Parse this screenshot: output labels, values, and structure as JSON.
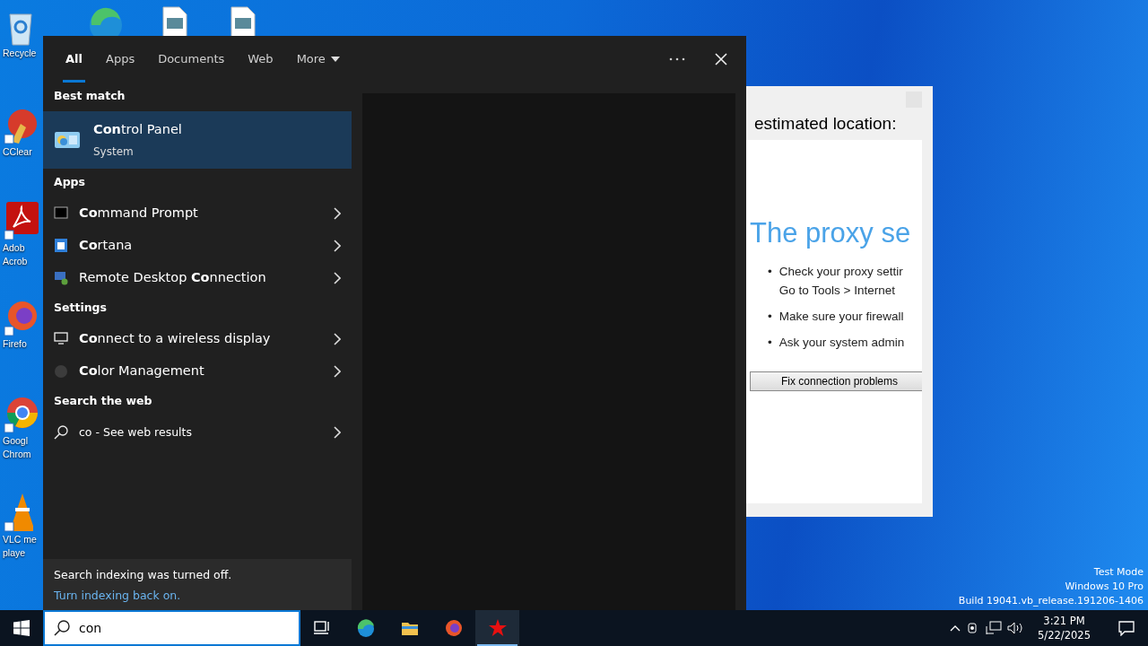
{
  "desktop": {
    "icons": [
      {
        "kind": "recycle",
        "lines": [
          "Recycle"
        ]
      },
      {
        "kind": "edge"
      },
      {
        "kind": "file"
      },
      {
        "kind": "file"
      },
      {
        "kind": "ccleaner",
        "lines": [
          "CClear"
        ]
      },
      {
        "kind": "acrobat",
        "lines": [
          "Adob",
          "Acrob"
        ]
      },
      {
        "kind": "firefox",
        "lines": [
          "Firefo"
        ]
      },
      {
        "kind": "chrome",
        "lines": [
          "Googl",
          "Chrom"
        ]
      },
      {
        "kind": "vlc",
        "lines": [
          "VLC me",
          "playe"
        ]
      }
    ],
    "system_info": [
      "Test Mode",
      "Windows 10 Pro",
      "Build 19041.vb_release.191206-1406"
    ]
  },
  "background_window": {
    "heading": "estimated location:",
    "title": "The proxy se",
    "bullets": [
      {
        "marker": "•",
        "lines": [
          "Check your proxy settir",
          "Go to Tools > Internet"
        ]
      },
      {
        "marker": "•",
        "lines": [
          "Make sure your firewall"
        ]
      },
      {
        "marker": "•",
        "lines": [
          "Ask your system admin"
        ]
      }
    ],
    "button": "Fix connection problems"
  },
  "search_panel": {
    "tabs": [
      {
        "label": "All",
        "selected": true
      },
      {
        "label": "Apps",
        "selected": false
      },
      {
        "label": "Documents",
        "selected": false
      },
      {
        "label": "Web",
        "selected": false
      },
      {
        "label": "More",
        "selected": false,
        "dropdown": true
      }
    ],
    "best_match": {
      "heading": "Best match",
      "title": "**Con**trol Panel",
      "subtitle": "System",
      "selected": true
    },
    "sections": [
      {
        "heading": "Apps",
        "items": [
          {
            "kind": "cmd",
            "label": "**Co**mmand Prompt",
            "selected": false
          },
          {
            "kind": "cortana",
            "label": "**Co**rtana",
            "selected": false
          },
          {
            "kind": "rdp",
            "label": "Remote Desktop **Co**nnection",
            "selected": false
          }
        ]
      },
      {
        "heading": "Settings",
        "items": [
          {
            "kind": "display",
            "label": "**Co**nnect to a wireless display",
            "selected": false
          },
          {
            "kind": "color",
            "label": "**Co**lor Management",
            "selected": false
          }
        ]
      },
      {
        "heading": "Search the web",
        "items": [
          {
            "kind": "web",
            "label": "co - See web results",
            "selected": false
          }
        ]
      }
    ],
    "footer": {
      "text": "Search indexing was turned off.",
      "link": "Turn indexing back on."
    }
  },
  "taskbar": {
    "search": {
      "value": "con"
    },
    "apps": [
      {
        "kind": "taskview",
        "active": false
      },
      {
        "kind": "edge",
        "active": false
      },
      {
        "kind": "explorer",
        "active": false
      },
      {
        "kind": "firefox",
        "active": false
      },
      {
        "kind": "star",
        "active": true
      }
    ],
    "time": "3:21 PM",
    "date": "5/22/2025"
  }
}
